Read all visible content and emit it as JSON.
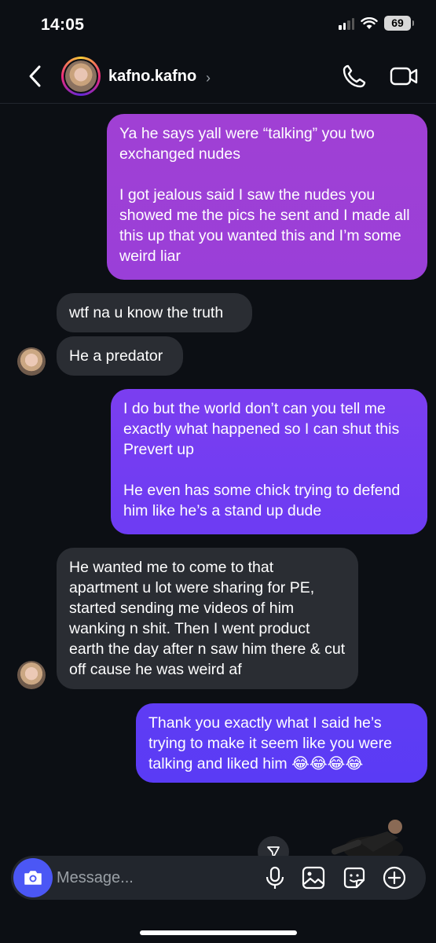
{
  "status": {
    "time": "14:05",
    "battery": "69"
  },
  "header": {
    "username": "kafno.kafno"
  },
  "messages": [
    {
      "from": "me",
      "text": "Ya he says yall were “talking” you two exchanged nudes\n\nI got jealous said I saw the nudes you showed me the pics he sent and I made all this up that you wanted this and I’m some weird liar"
    },
    {
      "from": "them",
      "text": "wtf na u know the truth"
    },
    {
      "from": "them",
      "text": "He a predator"
    },
    {
      "from": "me",
      "text": "I do but the world don’t can you tell me exactly what happened so I can shut this Prevert up\n\nHe even has some chick trying to defend him like he’s a stand up dude"
    },
    {
      "from": "them",
      "text": "He wanted me to come to that apartment u lot were sharing for PE, started sending me videos of him wanking n shit. Then I went product earth the day after n saw him there & cut off cause he was weird af"
    },
    {
      "from": "me",
      "text": "Thank you exactly what I said he’s trying to make it seem like you were talking and liked him 😂😂😂😂"
    }
  ],
  "composer": {
    "placeholder": "Message..."
  },
  "icons": {
    "back": "chevron-left-icon",
    "call": "phone-icon",
    "video": "video-camera-icon",
    "camera": "camera-icon",
    "mic": "microphone-icon",
    "gallery": "image-icon",
    "sticker": "sticker-icon",
    "add": "plus-circle-icon"
  },
  "colors": {
    "background": "#0c0f14",
    "sent_top": "#9b3fd6",
    "sent_bottom": "#6a3cf0",
    "received": "#2a2d33",
    "camera_button": "#4b57f5"
  }
}
